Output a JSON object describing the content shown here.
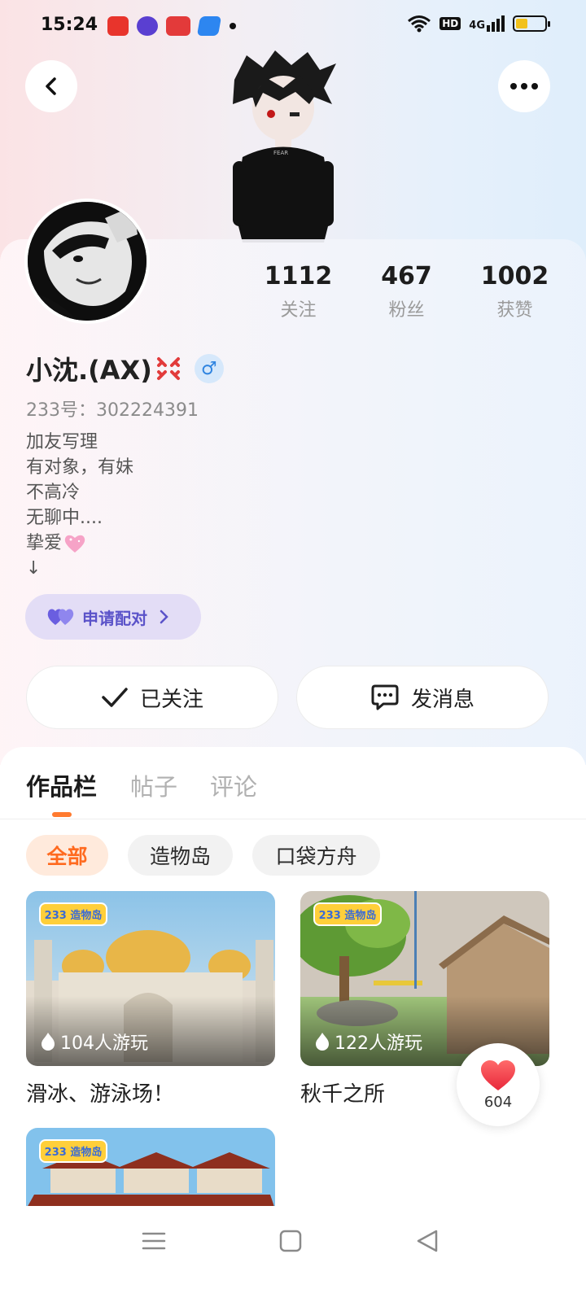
{
  "status_bar": {
    "time": "15:24",
    "app_icons": [
      "video-app-icon",
      "browser-app-icon",
      "news-app-icon",
      "store-app-icon"
    ],
    "indicators": [
      "wifi-icon",
      "hd-icon",
      "4g-signal-icon",
      "battery-icon"
    ],
    "hd_label": "HD",
    "network_label": "4G"
  },
  "header": {
    "back_icon": "chevron-left-icon",
    "more_icon": "more-dots-icon"
  },
  "profile": {
    "stats": [
      {
        "value": "1112",
        "label": "关注"
      },
      {
        "value": "467",
        "label": "粉丝"
      },
      {
        "value": "1002",
        "label": "获赞"
      }
    ],
    "nickname": "小沈.(AX)",
    "gender_symbol": "♂",
    "user_id": "233号：302224391",
    "bio_lines": [
      "加友写理",
      "有对象，有妹",
      "不高冷",
      "无聊中....",
      "挚爱",
      "↓"
    ],
    "pair_button_label": "申请配对",
    "follow_button_label": "已关注",
    "message_button_label": "发消息"
  },
  "tabs": [
    {
      "label": "作品栏",
      "active": true
    },
    {
      "label": "帖子",
      "active": false
    },
    {
      "label": "评论",
      "active": false
    }
  ],
  "filter_chips": [
    {
      "label": "全部",
      "active": true
    },
    {
      "label": "造物岛",
      "active": false
    },
    {
      "label": "口袋方舟",
      "active": false
    }
  ],
  "works": [
    {
      "title": "滑冰、游泳场！",
      "plays": "104人游玩",
      "badge": "233 造物岛"
    },
    {
      "title": "秋千之所",
      "plays": "122人游玩",
      "badge": "233 造物岛"
    },
    {
      "title": "",
      "plays": "",
      "badge": "233 造物岛"
    }
  ],
  "like_fab": {
    "count": "604"
  },
  "nav_bar": [
    "menu-icon",
    "home-square-icon",
    "back-triangle-icon"
  ],
  "colors": {
    "accent": "#ff7a2f",
    "pair_bg": "#e3ddf6",
    "pair_text": "#5b53c9",
    "gender_blue": "#2f84e0"
  }
}
